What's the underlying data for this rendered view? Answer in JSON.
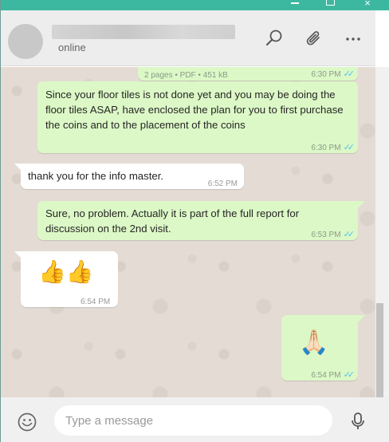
{
  "window": {
    "controls": {
      "minimize": "minimize",
      "maximize": "maximize",
      "close": "×"
    }
  },
  "header": {
    "status": "online",
    "icons": [
      "search-icon",
      "paperclip-icon",
      "menu-dots-icon"
    ]
  },
  "messages": [
    {
      "direction": "out",
      "kind": "document",
      "info": "2 pages • PDF • 451 kB",
      "time": "6:30 PM"
    },
    {
      "direction": "out",
      "kind": "text",
      "text": "Since your floor tiles is not done yet and you may be doing the floor tiles ASAP, have enclosed the plan for you to first purchase the coins and to the placement of the coins",
      "time": "6:30 PM"
    },
    {
      "direction": "in",
      "kind": "text",
      "text": "thank you for the info master.",
      "time": "6:52 PM"
    },
    {
      "direction": "out",
      "kind": "text",
      "text": "Sure, no problem. Actually it is part of the full report for discussion on the 2nd visit.",
      "time": "6:53 PM"
    },
    {
      "direction": "in",
      "kind": "emoji",
      "text": "👍👍",
      "time": "6:54 PM"
    },
    {
      "direction": "out",
      "kind": "emoji",
      "text": "🙏🏻",
      "time": "6:54 PM"
    }
  ],
  "composer": {
    "placeholder": "Type a message",
    "value": ""
  },
  "colors": {
    "titlebar": "#3db8a0",
    "outgoing_bubble": "#dcf8c6",
    "incoming_bubble": "#ffffff",
    "chat_background": "#e4dcd4",
    "read_ticks": "#4fc3f7"
  }
}
